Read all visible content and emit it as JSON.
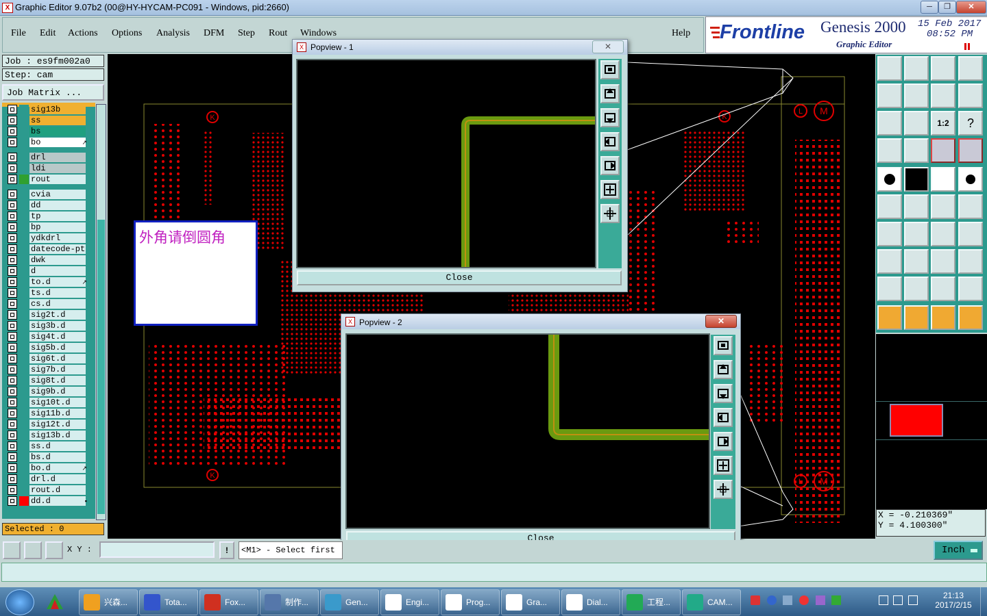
{
  "window": {
    "title": "Graphic Editor 9.07b2 (00@HY-HYCAM-PC091 - Windows, pid:2660)",
    "min": "─",
    "max": "❐",
    "close": "✕"
  },
  "menu": {
    "items": [
      "File",
      "Edit",
      "Actions",
      "Options",
      "Analysis",
      "DFM",
      "Step",
      "Rout",
      "Windows"
    ],
    "help": "Help"
  },
  "brand": {
    "logo": "Frontline",
    "product": "Genesis 2000",
    "subtitle": "Graphic Editor",
    "date": "15 Feb 2017",
    "time": "08:52 PM"
  },
  "job": {
    "job_label": "Job : es9fm002a0",
    "step_label": "Step: cam",
    "matrix_button": "Job Matrix ..."
  },
  "layers": [
    {
      "name": "sig13b",
      "color": "#f0b030"
    },
    {
      "name": "ss",
      "color": "#f0b030"
    },
    {
      "name": "bs",
      "color": "#20a080"
    },
    {
      "name": "bo",
      "color": "#ffffff",
      "mark": "↗"
    },
    {
      "name": "drl",
      "color": "#b8c8c8"
    },
    {
      "name": "ldi",
      "color": "#b8c8c8"
    },
    {
      "name": "rout",
      "color": "#d6eeee",
      "swatch": "#30a030"
    },
    {
      "name": "cvia"
    },
    {
      "name": "dd"
    },
    {
      "name": "tp"
    },
    {
      "name": "bp"
    },
    {
      "name": "ydkdrl"
    },
    {
      "name": "datecode-pt"
    },
    {
      "name": "dwk"
    },
    {
      "name": "d"
    },
    {
      "name": "to.d",
      "mark": "↗"
    },
    {
      "name": "ts.d"
    },
    {
      "name": "cs.d"
    },
    {
      "name": "sig2t.d"
    },
    {
      "name": "sig3b.d"
    },
    {
      "name": "sig4t.d"
    },
    {
      "name": "sig5b.d"
    },
    {
      "name": "sig6t.d"
    },
    {
      "name": "sig7b.d"
    },
    {
      "name": "sig8t.d"
    },
    {
      "name": "sig9b.d"
    },
    {
      "name": "sig10t.d"
    },
    {
      "name": "sig11b.d"
    },
    {
      "name": "sig12t.d"
    },
    {
      "name": "sig13b.d"
    },
    {
      "name": "ss.d"
    },
    {
      "name": "bs.d"
    },
    {
      "name": "bo.d",
      "mark": "↗"
    },
    {
      "name": "drl.d"
    },
    {
      "name": "rout.d"
    },
    {
      "name": "dd.d",
      "swatch": "#ff0000",
      "mark": "▪"
    }
  ],
  "selected": "Selected : 0",
  "note": {
    "text": "外角请倒圆角"
  },
  "popview1": {
    "title": "Popview - 1",
    "close_label": "Close"
  },
  "popview2": {
    "title": "Popview - 2",
    "close_label": "Close"
  },
  "coords": {
    "x": "X = -0.210369\"",
    "y": "Y = 4.100300\""
  },
  "cmd": {
    "xy_label": "X Y :",
    "xy_value": "",
    "prompt": "<M1> - Select first",
    "units": "Inch"
  },
  "taskbar": {
    "items": [
      "兴森...",
      "Tota...",
      "Fox...",
      "制作...",
      "Gen...",
      "Engi...",
      "Prog...",
      "Gra...",
      "Dial...",
      "工程...",
      "CAM..."
    ],
    "time": "21:13",
    "date": "2017/2/15"
  },
  "colors": {
    "accent": "#f0b030",
    "pcb_red": "#e00000",
    "trace_green": "#6a9a10"
  }
}
